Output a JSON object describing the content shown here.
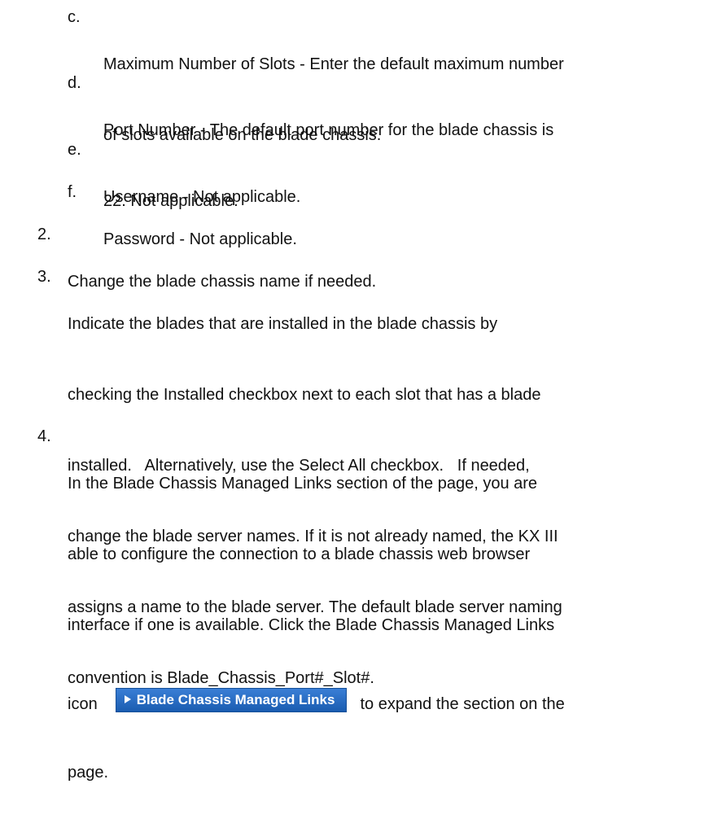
{
  "sub_items": [
    {
      "marker": "c.",
      "lines": [
        "Maximum Number of Slots - Enter the default maximum number",
        "of slots available on the blade chassis."
      ]
    },
    {
      "marker": "d.",
      "lines": [
        "Port Number - The default port number for the blade chassis is",
        "22. Not applicable."
      ]
    },
    {
      "marker": "e.",
      "lines": [
        "Username - Not applicable."
      ]
    },
    {
      "marker": "f.",
      "lines": [
        "Password - Not applicable."
      ]
    }
  ],
  "steps": [
    {
      "marker": "2.",
      "lines": [
        "Change the blade chassis name if needed."
      ]
    },
    {
      "marker": "3.",
      "lines": [
        "Indicate the blades that are installed in the blade chassis by",
        "checking the Installed checkbox next to each slot that has a blade",
        "installed.   Alternatively, use the Select All checkbox.   If needed,",
        "change the blade server names. If it is not already named, the KX III",
        "assigns a name to the blade server. The default blade server naming",
        "convention is Blade_Chassis_Port#_Slot#."
      ]
    },
    {
      "marker": "4.",
      "lines": [
        "In the Blade Chassis Managed Links section of the page, you are",
        "able to configure the connection to a blade chassis web browser",
        "interface if one is available. Click the Blade Chassis Managed Links"
      ]
    }
  ],
  "step4_tail": {
    "icon_word": "icon",
    "button_label": "Blade Chassis Managed Links",
    "after_button": "to expand the section on the",
    "last_line": "page."
  }
}
